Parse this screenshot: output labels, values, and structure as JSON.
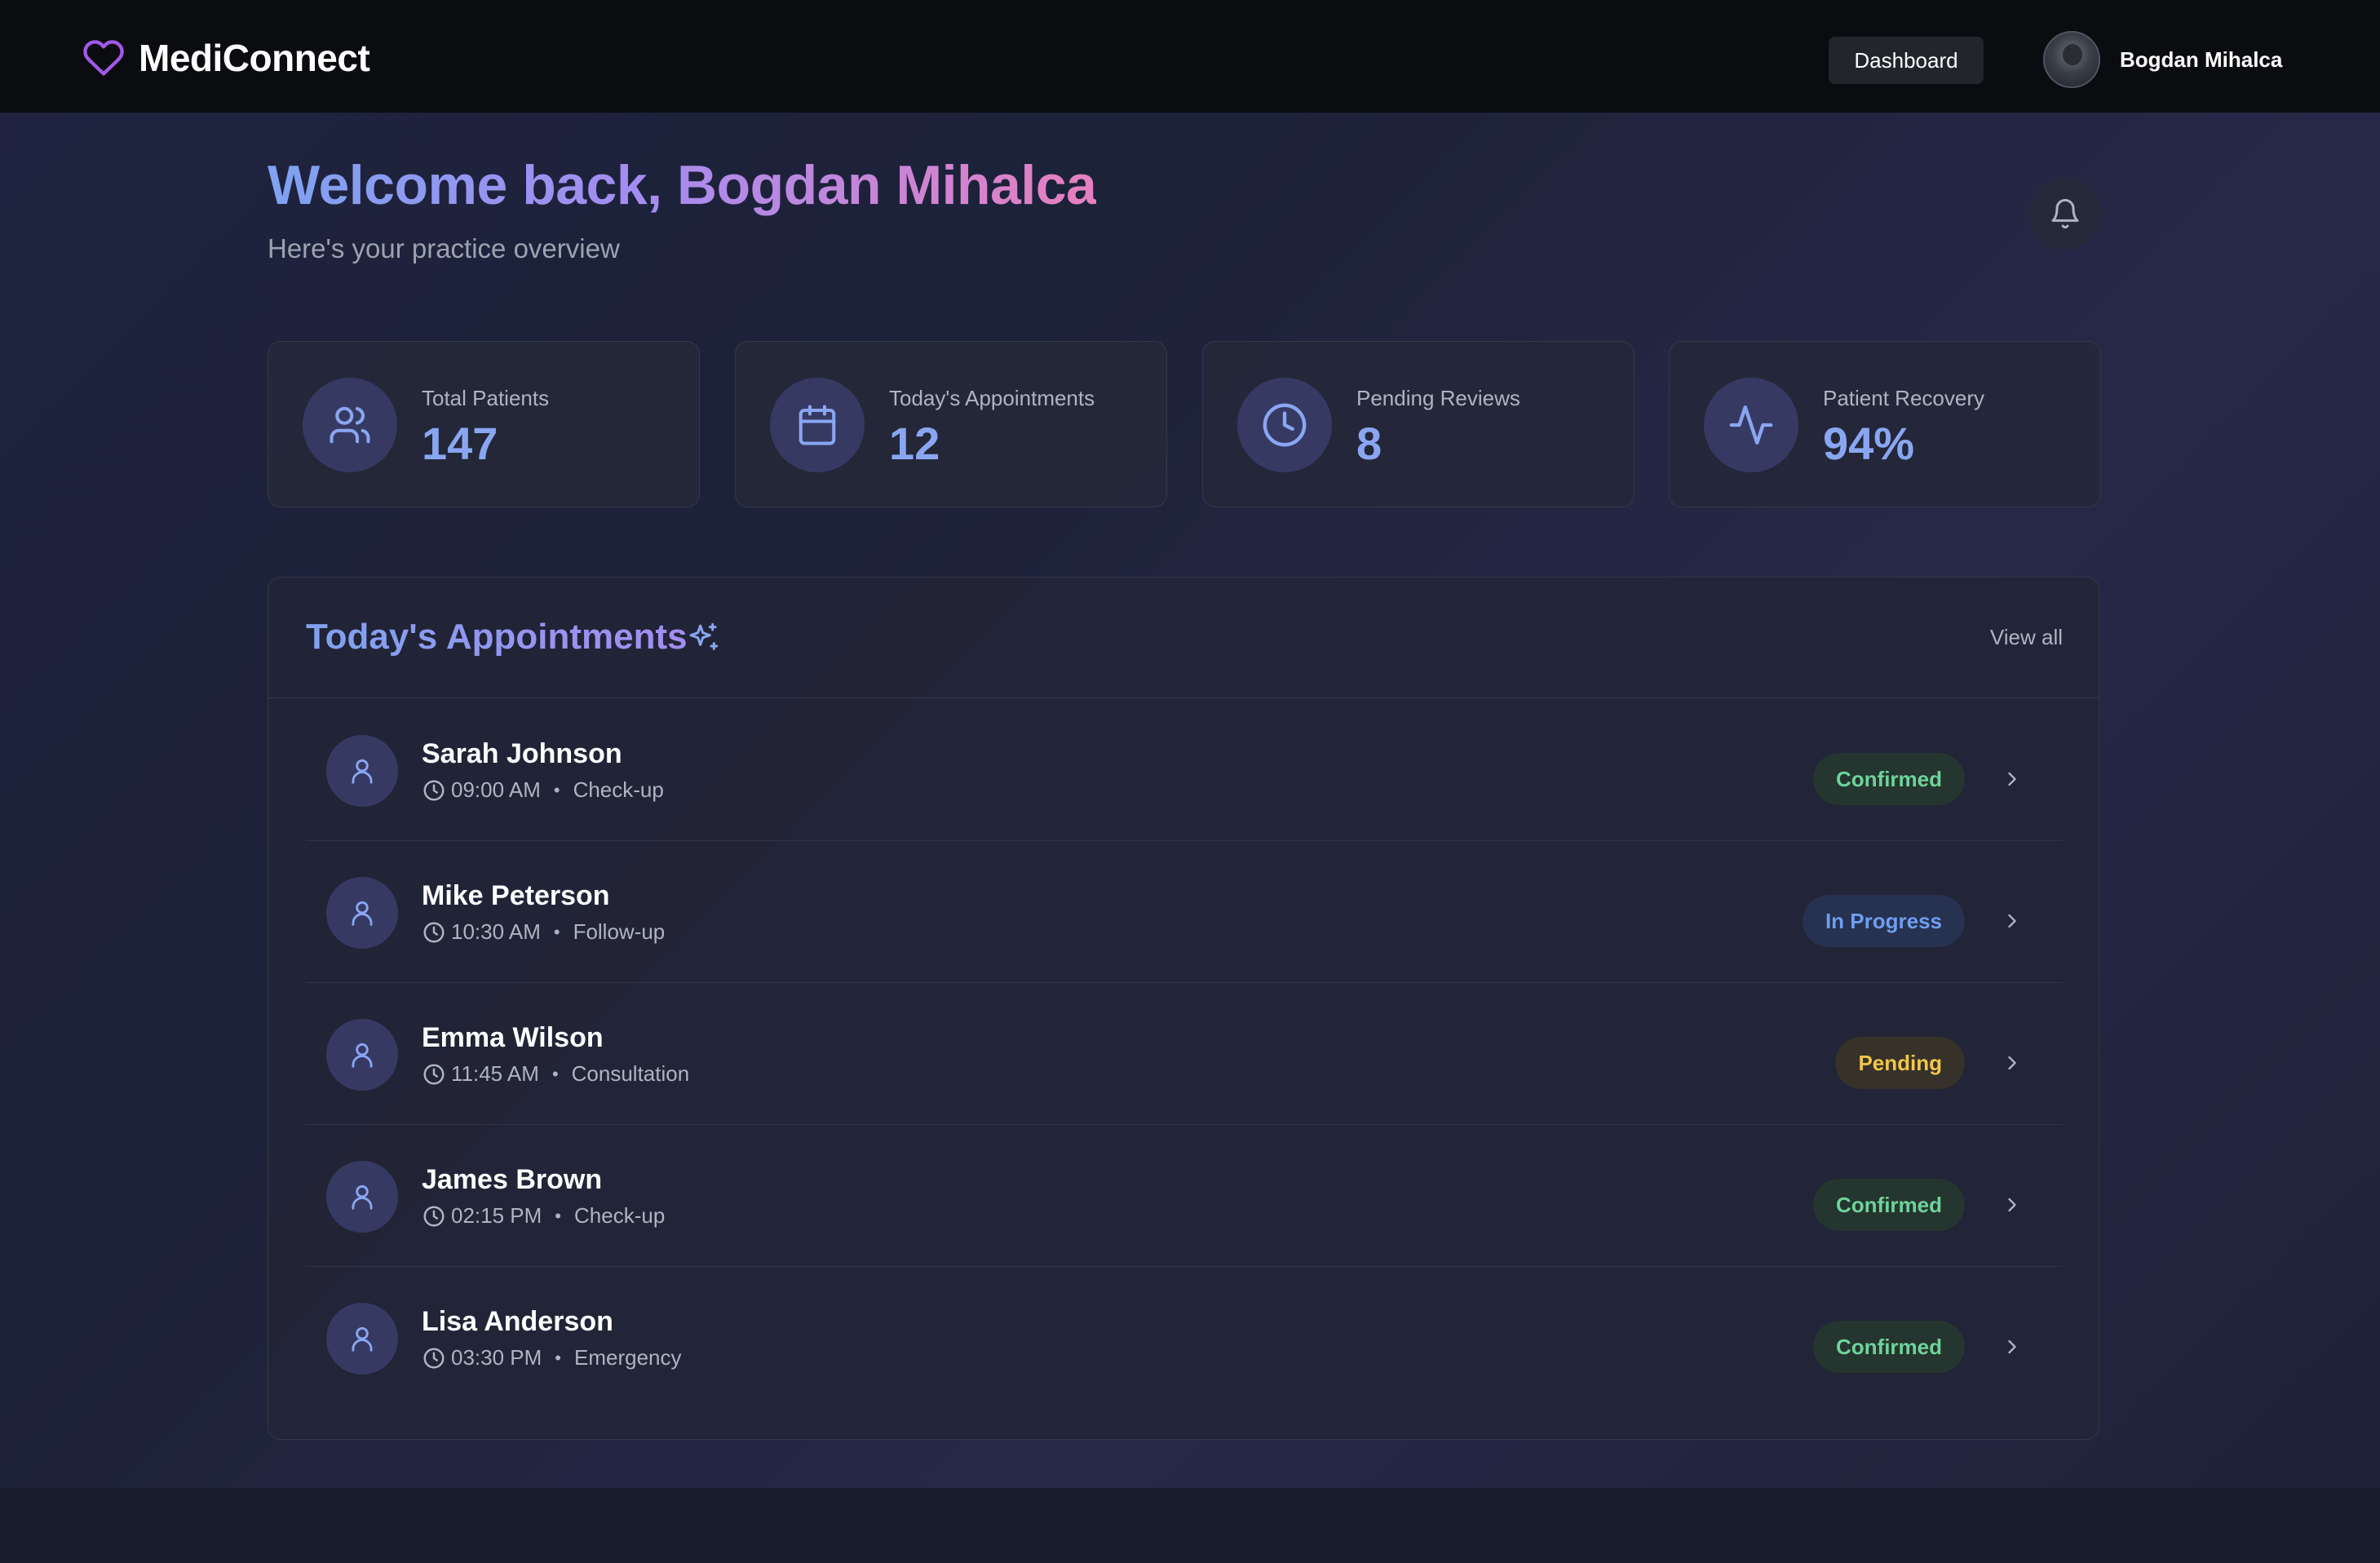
{
  "app": {
    "name": "MediConnect"
  },
  "nav": {
    "dashboard_label": "Dashboard"
  },
  "user": {
    "name": "Bogdan Mihalca"
  },
  "welcome": {
    "title": "Welcome back, Bogdan Mihalca",
    "subtitle": "Here's your practice overview"
  },
  "stats": [
    {
      "label": "Total Patients",
      "value": "147",
      "icon": "users-icon"
    },
    {
      "label": "Today's Appointments",
      "value": "12",
      "icon": "calendar-icon"
    },
    {
      "label": "Pending Reviews",
      "value": "8",
      "icon": "clock-icon"
    },
    {
      "label": "Patient Recovery",
      "value": "94%",
      "icon": "activity-icon"
    }
  ],
  "appointments": {
    "title": "Today's Appointments",
    "view_all": "View all",
    "items": [
      {
        "name": "Sarah Johnson",
        "time": "09:00 AM",
        "type": "Check-up",
        "status": "Confirmed"
      },
      {
        "name": "Mike Peterson",
        "time": "10:30 AM",
        "type": "Follow-up",
        "status": "In Progress"
      },
      {
        "name": "Emma Wilson",
        "time": "11:45 AM",
        "type": "Consultation",
        "status": "Pending"
      },
      {
        "name": "James Brown",
        "time": "02:15 PM",
        "type": "Check-up",
        "status": "Confirmed"
      },
      {
        "name": "Lisa Anderson",
        "time": "03:30 PM",
        "type": "Emergency",
        "status": "Confirmed"
      }
    ]
  },
  "colors": {
    "accent_blue": "#8aa6f2",
    "accent_purple": "#a58cf0",
    "accent_pink": "#e77fc0",
    "status_confirmed": "#6fd39a",
    "status_in_progress": "#6f9ef0",
    "status_pending": "#f2c64a"
  }
}
